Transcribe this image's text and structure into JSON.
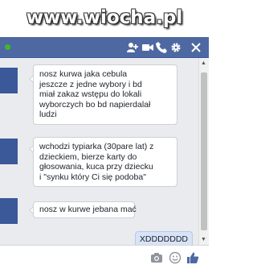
{
  "watermark": {
    "text": "www.wiocha.pl"
  },
  "chat": {
    "status": "online",
    "messages": [
      {
        "from": "other",
        "lines": [
          "nosz kurwa jaka cebula",
          "jeszcze z jedne wybory i bd",
          "miał zakaz wstępu do lokali",
          "wyborczych bo bd napierdalał",
          "ludzi"
        ]
      },
      {
        "from": "other",
        "lines": [
          "wchodzi typiarka (30pare lat) z",
          "dzieckiem, bierze karty do",
          "głosowania, kuca przy dziecku",
          "i \"synku który Ci się podoba\""
        ]
      },
      {
        "from": "other",
        "lines": [
          "nosz w kurwe jebana mać"
        ]
      },
      {
        "from": "self",
        "lines": [
          "XDDDDDDD"
        ]
      }
    ]
  },
  "icons": {
    "header": [
      "add-friend-icon",
      "video-call-icon",
      "phone-icon",
      "gear-icon",
      "close-icon"
    ],
    "compose": [
      "camera-icon",
      "emoji-icon",
      "like-icon"
    ]
  },
  "colors": {
    "header": "#4e69a2",
    "avatar": "#3b5998",
    "chat_bg": "#e9ebee",
    "self_bubble": "#d8e3f7",
    "online": "#42b72a"
  }
}
